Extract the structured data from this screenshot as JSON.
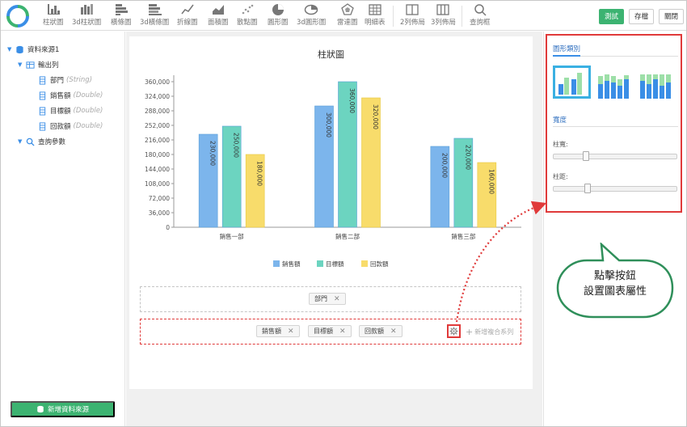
{
  "toolbar": {
    "items": [
      {
        "label": "柱狀圖",
        "icon": "bar-chart-icon"
      },
      {
        "label": "3d柱狀圖",
        "icon": "bar-3d-icon"
      },
      {
        "label": "橫條圖",
        "icon": "horizontal-bar-icon"
      },
      {
        "label": "3d橫條圖",
        "icon": "horizontal-bar-3d-icon"
      },
      {
        "label": "折線圖",
        "icon": "line-chart-icon"
      },
      {
        "label": "面積圖",
        "icon": "area-chart-icon"
      },
      {
        "label": "散點圖",
        "icon": "scatter-chart-icon"
      },
      {
        "label": "圓形圖",
        "icon": "pie-chart-icon"
      },
      {
        "label": "3d圓形圖",
        "icon": "pie-3d-icon"
      },
      {
        "label": "雷達圖",
        "icon": "radar-chart-icon"
      },
      {
        "label": "明細表",
        "icon": "table-icon"
      },
      {
        "label": "2列佈局",
        "icon": "two-column-icon"
      },
      {
        "label": "3列佈局",
        "icon": "three-column-icon"
      },
      {
        "label": "查詢框",
        "icon": "search-icon"
      }
    ],
    "test_label": "測試",
    "save_label": "存檔",
    "close_label": "關閉"
  },
  "tree": {
    "root": "資料來源1",
    "output": "輸出列",
    "fields": [
      {
        "name": "部門",
        "type": "(String)"
      },
      {
        "name": "銷售額",
        "type": "(Double)"
      },
      {
        "name": "目標額",
        "type": "(Double)"
      },
      {
        "name": "回款額",
        "type": "(Double)"
      }
    ],
    "params": "查詢參數",
    "add_source_label": "新增資料來源"
  },
  "chart_data": {
    "type": "bar",
    "title": "柱狀圖",
    "categories": [
      "銷售一部",
      "銷售二部",
      "銷售三部"
    ],
    "series": [
      {
        "name": "銷售額",
        "values": [
          230000,
          300000,
          200000
        ],
        "color": "#7cb5ec"
      },
      {
        "name": "目標額",
        "values": [
          250000,
          360000,
          220000
        ],
        "color": "#6cd4c0"
      },
      {
        "name": "回款額",
        "values": [
          180000,
          320000,
          160000
        ],
        "color": "#f8dc6b"
      }
    ],
    "data_labels": [
      [
        "230,000",
        "250,000",
        "180,000"
      ],
      [
        "300,000",
        "360,000",
        "320,000"
      ],
      [
        "200,000",
        "220,000",
        "160,000"
      ]
    ],
    "ylim": [
      0,
      360000
    ],
    "yticks": [
      "0",
      "36,000",
      "72,000",
      "108,000",
      "144,000",
      "180,000",
      "216,000",
      "252,000",
      "288,000",
      "324,000",
      "360,000"
    ],
    "legend_position": "bottom"
  },
  "drop": {
    "category_chips": [
      "部門"
    ],
    "series_chips": [
      "銷售額",
      "目標額",
      "回款額"
    ],
    "add_series_label": "新增複合系列"
  },
  "props": {
    "chart_type_title": "圖形類別",
    "width_title": "寬度",
    "bar_width_label": "柱寬:",
    "bar_width_value": 0.25,
    "bar_gap_label": "柱距:",
    "bar_gap_value": 0.27
  },
  "callout": {
    "line1": "點擊按鈕",
    "line2": "設置圖表屬性"
  }
}
